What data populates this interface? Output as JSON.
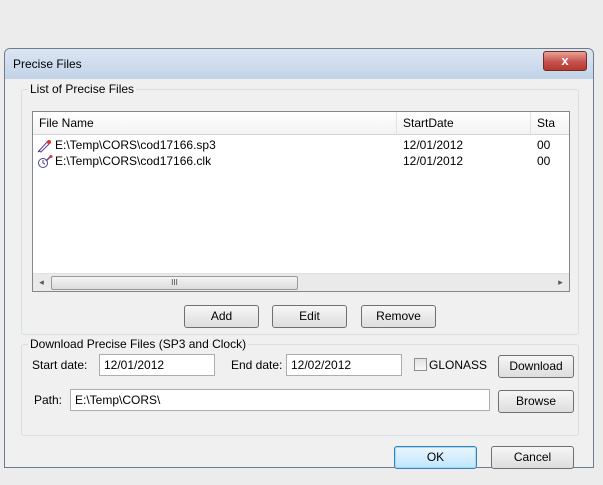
{
  "dialog": {
    "title": "Precise Files",
    "close_glyph": "x"
  },
  "list_group": {
    "legend": "List of Precise Files",
    "columns": [
      "File Name",
      "StartDate",
      "Sta"
    ],
    "rows": [
      {
        "icon": "sp3-file-icon",
        "name": "E:\\Temp\\CORS\\cod17166.sp3",
        "start_date": "12/01/2012",
        "start_time": "00"
      },
      {
        "icon": "clock-file-icon",
        "name": "E:\\Temp\\CORS\\cod17166.clk",
        "start_date": "12/01/2012",
        "start_time": "00"
      }
    ],
    "scroll_left": "◂",
    "scroll_right": "▸",
    "scroll_grip": "III",
    "buttons": {
      "add": "Add",
      "edit": "Edit",
      "remove": "Remove"
    }
  },
  "download_group": {
    "legend": "Download Precise Files (SP3 and Clock)",
    "start_label": "Start date:",
    "start_value": "12/01/2012",
    "end_label": "End date:",
    "end_value": "12/02/2012",
    "glonass_label": "GLONASS",
    "glonass_checked": false,
    "download_button": "Download",
    "path_label": "Path:",
    "path_value": "E:\\Temp\\CORS\\",
    "browse_button": "Browse"
  },
  "footer": {
    "ok": "OK",
    "cancel": "Cancel"
  },
  "colors": {
    "accent": "#3c7fb1",
    "close": "#c75050"
  }
}
